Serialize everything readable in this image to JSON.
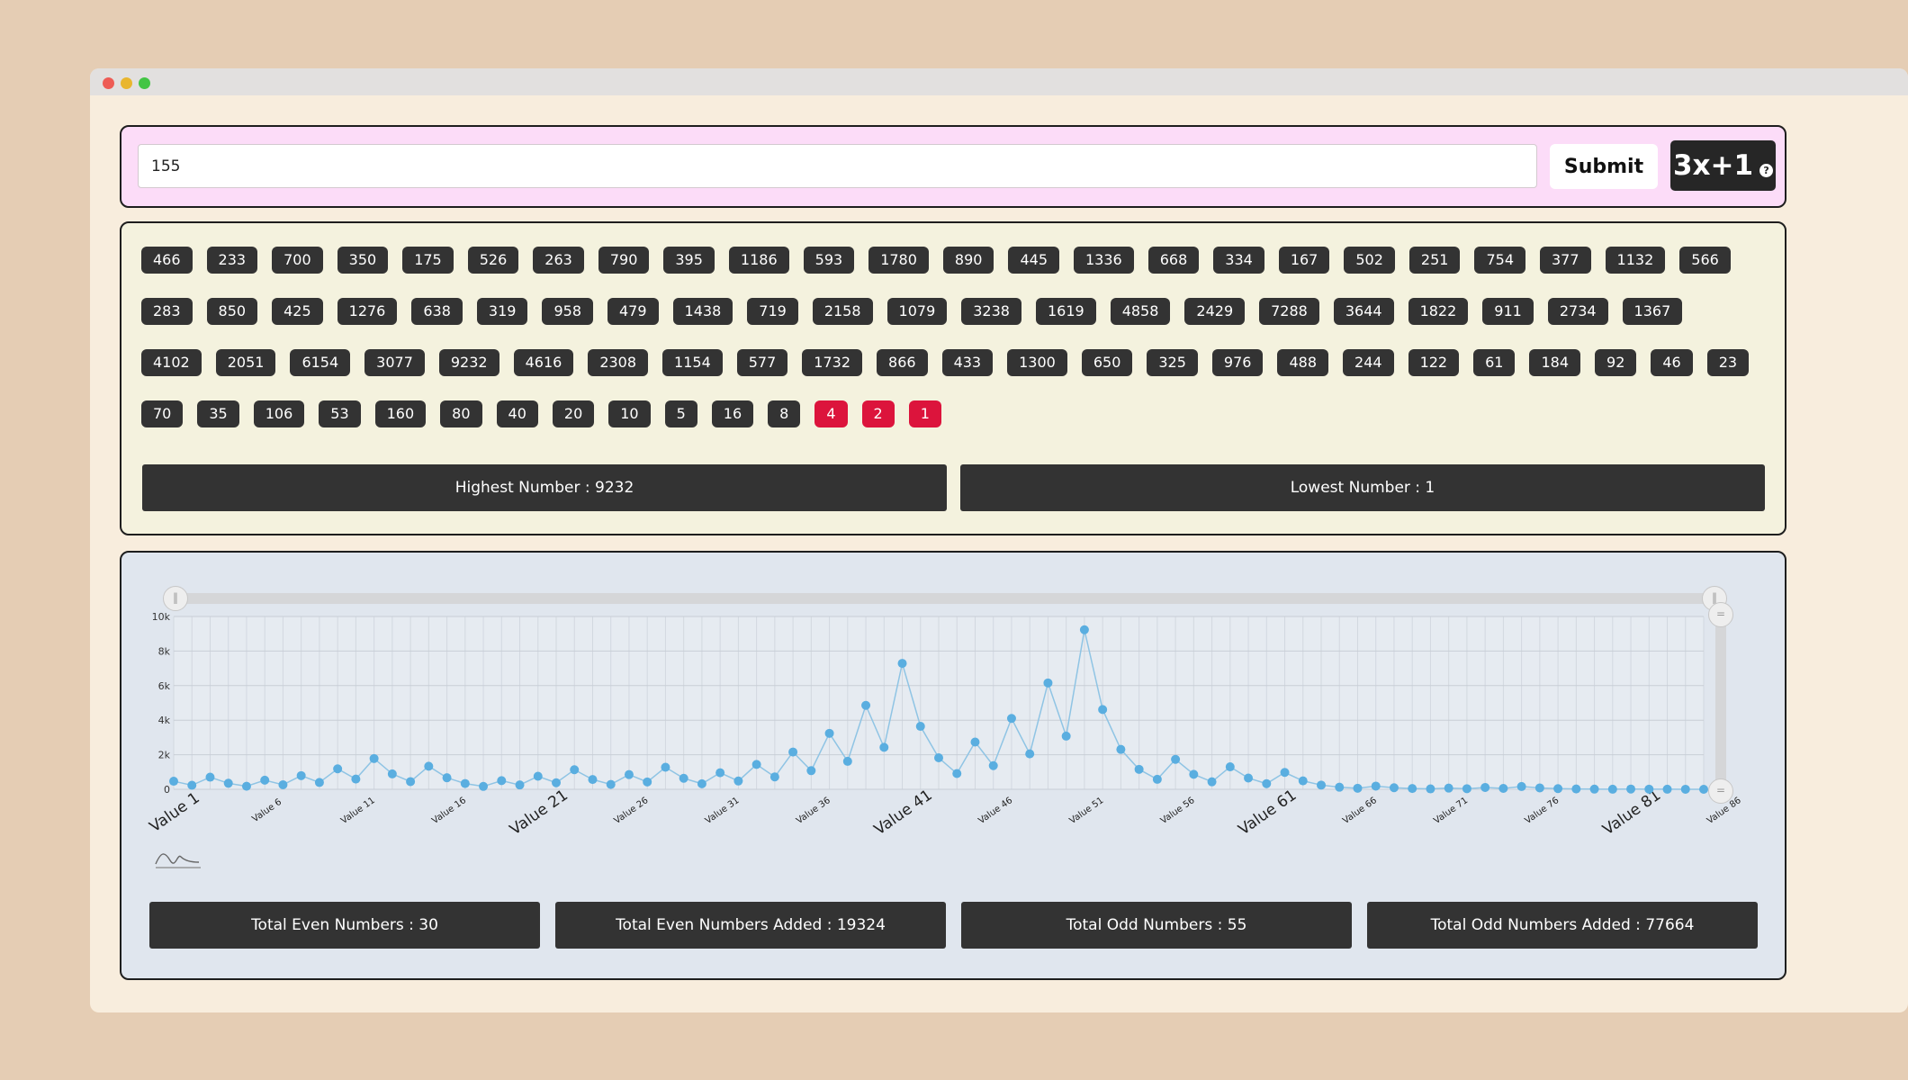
{
  "input": {
    "value": "155"
  },
  "buttons": {
    "submit_label": "Submit",
    "brand_label": "3x+1",
    "help_glyph": "?"
  },
  "sequence": [
    466,
    233,
    700,
    350,
    175,
    526,
    263,
    790,
    395,
    1186,
    593,
    1780,
    890,
    445,
    1336,
    668,
    334,
    167,
    502,
    251,
    754,
    377,
    1132,
    566,
    283,
    850,
    425,
    1276,
    638,
    319,
    958,
    479,
    1438,
    719,
    2158,
    1079,
    3238,
    1619,
    4858,
    2429,
    7288,
    3644,
    1822,
    911,
    2734,
    1367,
    4102,
    2051,
    6154,
    3077,
    9232,
    4616,
    2308,
    1154,
    577,
    1732,
    866,
    433,
    1300,
    650,
    325,
    976,
    488,
    244,
    122,
    61,
    184,
    92,
    46,
    23,
    70,
    35,
    106,
    53,
    160,
    80,
    40,
    20,
    10,
    5,
    16,
    8,
    4,
    2,
    1
  ],
  "highlighted": [
    4,
    2,
    1
  ],
  "stats": {
    "highest": "Highest Number : 9232",
    "lowest": "Lowest Number : 1",
    "total_even": "Total Even Numbers : 30",
    "total_even_added": "Total Even Numbers Added : 19324",
    "total_odd": "Total Odd Numbers : 55",
    "total_odd_added": "Total Odd Numbers Added : 77664"
  },
  "colors": {
    "highlight": "#dc143c",
    "chip": "#333333",
    "series": "#5aaee0"
  },
  "chart_data": {
    "type": "line",
    "y_ticks": [
      "0",
      "2k",
      "4k",
      "6k",
      "8k",
      "10k"
    ],
    "ylim": [
      0,
      10000
    ],
    "x_labels": [
      "Value 1",
      "Value 6",
      "Value 11",
      "Value 16",
      "Value 21",
      "Value 26",
      "Value 31",
      "Value 36",
      "Value 41",
      "Value 46",
      "Value 51",
      "Value 56",
      "Value 61",
      "Value 66",
      "Value 71",
      "Value 76",
      "Value 81",
      "Value 86"
    ],
    "grid": true,
    "series": [
      {
        "values": [
          466,
          233,
          700,
          350,
          175,
          526,
          263,
          790,
          395,
          1186,
          593,
          1780,
          890,
          445,
          1336,
          668,
          334,
          167,
          502,
          251,
          754,
          377,
          1132,
          566,
          283,
          850,
          425,
          1276,
          638,
          319,
          958,
          479,
          1438,
          719,
          2158,
          1079,
          3238,
          1619,
          4858,
          2429,
          7288,
          3644,
          1822,
          911,
          2734,
          1367,
          4102,
          2051,
          6154,
          3077,
          9232,
          4616,
          2308,
          1154,
          577,
          1732,
          866,
          433,
          1300,
          650,
          325,
          976,
          488,
          244,
          122,
          61,
          184,
          92,
          46,
          23,
          70,
          35,
          106,
          53,
          160,
          80,
          40,
          20,
          10,
          5,
          16,
          8,
          4,
          2,
          1
        ]
      }
    ]
  }
}
